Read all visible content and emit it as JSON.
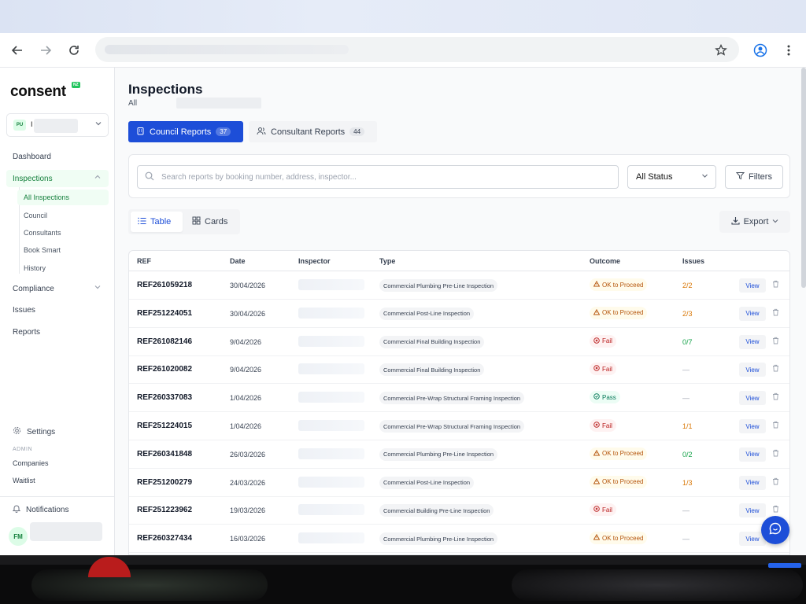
{
  "app": {
    "logo": "consent",
    "logo_badge": "NZ"
  },
  "org": {
    "initials": "PU",
    "name": "I"
  },
  "sidebar": {
    "items": [
      {
        "label": "Dashboard"
      },
      {
        "label": "Inspections"
      },
      {
        "label": "Compliance"
      },
      {
        "label": "Issues"
      },
      {
        "label": "Reports"
      }
    ],
    "subitems": [
      {
        "label": "All Inspections"
      },
      {
        "label": "Council"
      },
      {
        "label": "Consultants"
      },
      {
        "label": "Book Smart"
      },
      {
        "label": "History"
      }
    ],
    "settings": "Settings",
    "admin_label": "ADMIN",
    "admin_items": [
      {
        "label": "Companies"
      },
      {
        "label": "Waitlist"
      }
    ],
    "notifications": "Notifications",
    "user_initials": "FM"
  },
  "page": {
    "title": "Inspections",
    "subtitle": "All"
  },
  "tabs": [
    {
      "label": "Council Reports",
      "count": "37"
    },
    {
      "label": "Consultant Reports",
      "count": "44"
    }
  ],
  "filters": {
    "search_placeholder": "Search reports by booking number, address, inspector...",
    "status": "All Status",
    "filters_label": "Filters"
  },
  "view": {
    "table": "Table",
    "cards": "Cards",
    "export": "Export"
  },
  "table": {
    "headers": [
      "REF",
      "Date",
      "Inspector",
      "Type",
      "Outcome",
      "Issues"
    ],
    "view_label": "View",
    "rows": [
      {
        "ref": "REF261059218",
        "date": "30/04/2026",
        "type": "Commercial Plumbing Pre-Line Inspection",
        "outcome": "OK to Proceed",
        "status": "warn",
        "issues": "2/2",
        "issues_color": "orange"
      },
      {
        "ref": "REF251224051",
        "date": "30/04/2026",
        "type": "Commercial Post-Line Inspection",
        "outcome": "OK to Proceed",
        "status": "warn",
        "issues": "2/3",
        "issues_color": "orange"
      },
      {
        "ref": "REF261082146",
        "date": "9/04/2026",
        "type": "Commercial Final Building Inspection",
        "outcome": "Fail",
        "status": "fail",
        "issues": "0/7",
        "issues_color": "green"
      },
      {
        "ref": "REF261020082",
        "date": "9/04/2026",
        "type": "Commercial Final Building Inspection",
        "outcome": "Fail",
        "status": "fail",
        "issues": "—",
        "issues_color": "none"
      },
      {
        "ref": "REF260337083",
        "date": "1/04/2026",
        "type": "Commercial Pre-Wrap Structural Framing Inspection",
        "outcome": "Pass",
        "status": "pass",
        "issues": "—",
        "issues_color": "none"
      },
      {
        "ref": "REF251224015",
        "date": "1/04/2026",
        "type": "Commercial Pre-Wrap Structural Framing Inspection",
        "outcome": "Fail",
        "status": "fail",
        "issues": "1/1",
        "issues_color": "orange"
      },
      {
        "ref": "REF260341848",
        "date": "26/03/2026",
        "type": "Commercial Plumbing Pre-Line Inspection",
        "outcome": "OK to Proceed",
        "status": "warn",
        "issues": "0/2",
        "issues_color": "green"
      },
      {
        "ref": "REF251200279",
        "date": "24/03/2026",
        "type": "Commercial Post-Line Inspection",
        "outcome": "OK to Proceed",
        "status": "warn",
        "issues": "1/3",
        "issues_color": "orange"
      },
      {
        "ref": "REF251223962",
        "date": "19/03/2026",
        "type": "Commercial Building Pre-Line Inspection",
        "outcome": "Fail",
        "status": "fail",
        "issues": "—",
        "issues_color": "none"
      },
      {
        "ref": "REF260327434",
        "date": "16/03/2026",
        "type": "Commercial Plumbing Pre-Line Inspection",
        "outcome": "OK to Proceed",
        "status": "warn",
        "issues": "—",
        "issues_color": "none"
      }
    ]
  }
}
